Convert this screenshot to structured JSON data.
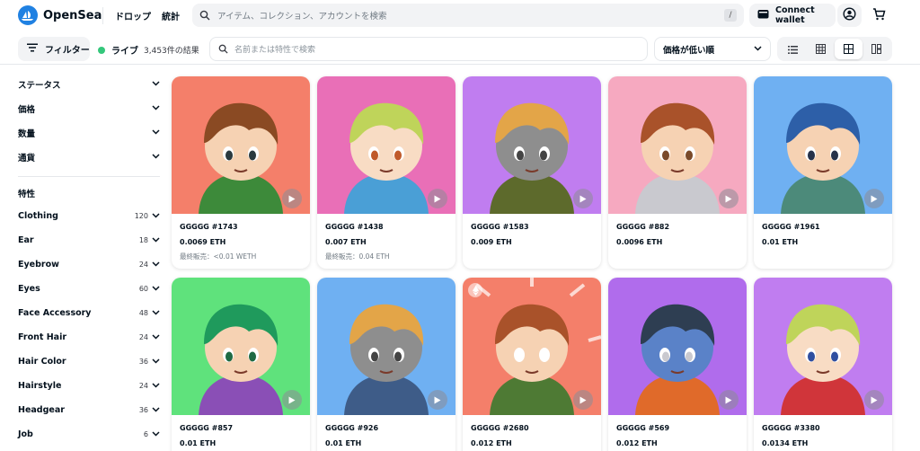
{
  "header": {
    "logo_text": "OpenSea",
    "nav": [
      "ドロップ",
      "統計"
    ],
    "search_placeholder": "アイテム、コレクション、アカウントを検索",
    "search_shortcut": "/",
    "connect_wallet": "Connect wallet"
  },
  "toolbar": {
    "filter_label": "フィルター",
    "live_label": "ライブ",
    "results": "3,453件の結果",
    "search_placeholder": "名前または特性で検索",
    "sort_label": "価格が低い順"
  },
  "sidebar": {
    "sections": [
      "ステータス",
      "価格",
      "数量",
      "通貨"
    ],
    "traits_heading": "特性",
    "traits": [
      {
        "label": "Clothing",
        "count": "120"
      },
      {
        "label": "Ear",
        "count": "18"
      },
      {
        "label": "Eyebrow",
        "count": "24"
      },
      {
        "label": "Eyes",
        "count": "60"
      },
      {
        "label": "Face Accessory",
        "count": "48"
      },
      {
        "label": "Front Hair",
        "count": "24"
      },
      {
        "label": "Hair Color",
        "count": "36"
      },
      {
        "label": "Hairstyle",
        "count": "24"
      },
      {
        "label": "Headgear",
        "count": "36"
      },
      {
        "label": "Job",
        "count": "6"
      }
    ]
  },
  "items": [
    {
      "name": "GGGGG #1743",
      "price": "0.0069 ETH",
      "last_sale": "最終販売：<0.01 WETH",
      "bg": "#f47f6a",
      "hair": "#8a4a23",
      "skin": "#f6d2b3",
      "outfit": "#3d8a3a",
      "accent": "#2b3a3f"
    },
    {
      "name": "GGGGG #1438",
      "price": "0.007 ETH",
      "last_sale": "最終販売：0.04 ETH",
      "bg": "#e96fb7",
      "hair": "#bfd45a",
      "skin": "#f8dcc4",
      "outfit": "#4a9fd6",
      "accent": "#c05a2a"
    },
    {
      "name": "GGGGG #1583",
      "price": "0.009 ETH",
      "last_sale": "",
      "bg": "#c07df0",
      "hair": "#e3a548",
      "skin": "#8e8e8e",
      "outfit": "#5d6a2c",
      "accent": "#444"
    },
    {
      "name": "GGGGG #882",
      "price": "0.0096 ETH",
      "last_sale": "",
      "bg": "#f6a9c0",
      "hair": "#a9522a",
      "skin": "#f6d2b3",
      "outfit": "#c9c9cf",
      "accent": "#7a4a2a"
    },
    {
      "name": "GGGGG #1961",
      "price": "0.01 ETH",
      "last_sale": "",
      "bg": "#6fb0f2",
      "hair": "#2d5fa8",
      "skin": "#f6d2b3",
      "outfit": "#4c8a7a",
      "accent": "#26324a"
    },
    {
      "name": "GGGGG #857",
      "price": "0.01 ETH",
      "last_sale": "",
      "bg": "#5fe27c",
      "hair": "#1f9a5c",
      "skin": "#f6d2b3",
      "outfit": "#8a4fb6",
      "accent": "#1f6a44"
    },
    {
      "name": "GGGGG #926",
      "price": "0.01 ETH",
      "last_sale": "",
      "bg": "#6fb0f2",
      "hair": "#e3a548",
      "skin": "#8e8e8e",
      "outfit": "#3e5c88",
      "accent": "#444"
    },
    {
      "name": "GGGGG #2680",
      "price": "0.012 ETH",
      "last_sale": "",
      "bg": "#f47f6a",
      "hair": "#a9522a",
      "skin": "#f6d2b3",
      "outfit": "#4e7a34",
      "accent": "#ffffff"
    },
    {
      "name": "GGGGG #569",
      "price": "0.012 ETH",
      "last_sale": "",
      "bg": "#b06cec",
      "hair": "#2e3e52",
      "skin": "#5a82c8",
      "outfit": "#e06a2a",
      "accent": "#c9c9cf"
    },
    {
      "name": "GGGGG #3380",
      "price": "0.0134 ETH",
      "last_sale": "",
      "bg": "#c07df0",
      "hair": "#bfd45a",
      "skin": "#f8dcc4",
      "outfit": "#d0353a",
      "accent": "#2f4fa0"
    }
  ]
}
